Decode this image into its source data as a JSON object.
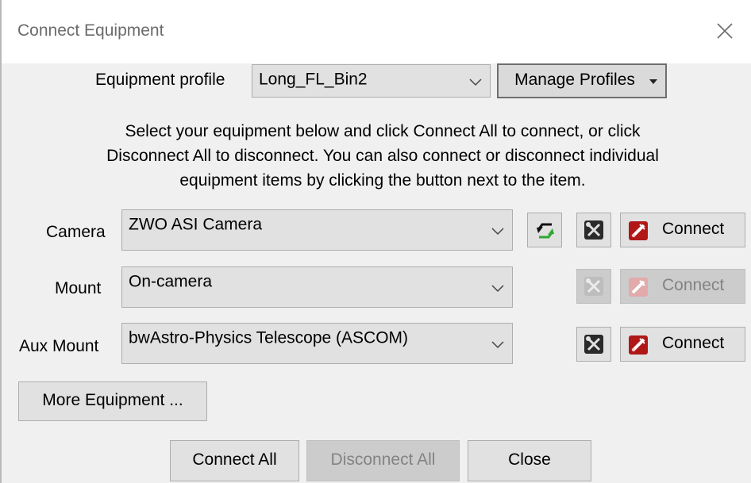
{
  "window": {
    "title": "Connect Equipment"
  },
  "profile": {
    "label": "Equipment profile",
    "value": "Long_FL_Bin2",
    "manage_label": "Manage Profiles"
  },
  "description": [
    "Select your equipment below and click Connect All to connect, or click",
    "Disconnect All to disconnect. You can also connect or disconnect individual",
    "equipment items by clicking the button next to the item."
  ],
  "equipment": {
    "camera": {
      "label": "Camera",
      "value": "ZWO ASI Camera",
      "connect_label": "Connect"
    },
    "mount": {
      "label": "Mount",
      "value": "On-camera",
      "connect_label": "Connect"
    },
    "aux_mount": {
      "label": "Aux Mount",
      "value": "bwAstro-Physics Telescope (ASCOM)",
      "connect_label": "Connect"
    }
  },
  "buttons": {
    "more_equipment": "More Equipment ...",
    "connect_all": "Connect All",
    "disconnect_all": "Disconnect All",
    "close": "Close"
  },
  "icons": {
    "close": "close-icon",
    "dropdown": "chevron-down-icon",
    "swap": "swap-arrows-icon",
    "settings": "tools-icon",
    "plug": "plug-icon"
  },
  "colors": {
    "accent_red": "#b01818",
    "swap_green": "#2fa82f",
    "window_bg": "#f0f0f0"
  }
}
